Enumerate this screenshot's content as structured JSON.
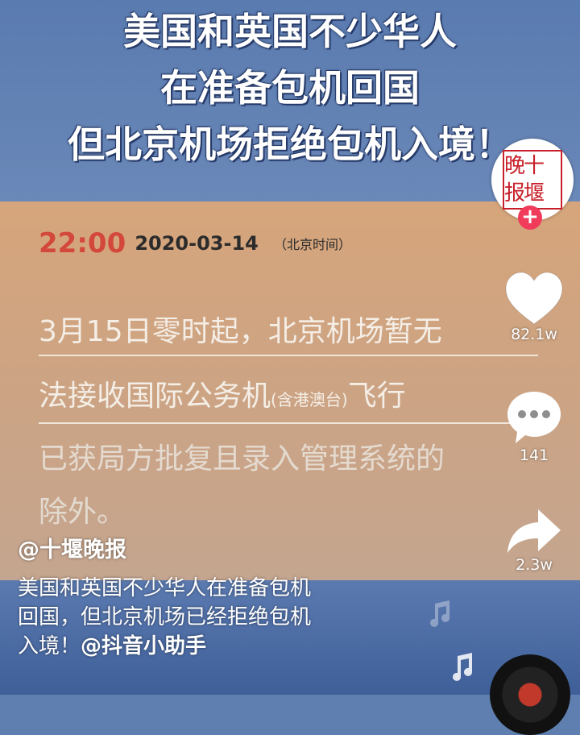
{
  "video": {
    "headline": [
      "美国和英国不少华人",
      "在准备包机回国",
      "但北京机场拒绝包机入境！"
    ],
    "notice": {
      "time": "22:00",
      "date": "2020-03-14",
      "timezone": "（北京时间）",
      "line1": "3月15日零时起，北京机场暂无",
      "line2_a": "法接收国际公务机",
      "line2_small": "(含港澳台)",
      "line2_b": "飞行",
      "line3": "已获局方批复且录入管理系统的",
      "line4": "除外。"
    }
  },
  "creator": {
    "avatar_text": "晚十报堰",
    "follow_label": "+"
  },
  "actions": {
    "likes": "82.1w",
    "comments": "141",
    "shares": "2.3w"
  },
  "post": {
    "author": "@十堰晚报",
    "caption_1": "美国和英国不少华人在准备包机",
    "caption_2": "回国，但北京机场已经拒绝包机",
    "caption_3": "入境！",
    "mention": "@抖音小助手"
  },
  "colors": {
    "accent_red": "#d3483a",
    "follow_pink": "#f03c5a"
  }
}
